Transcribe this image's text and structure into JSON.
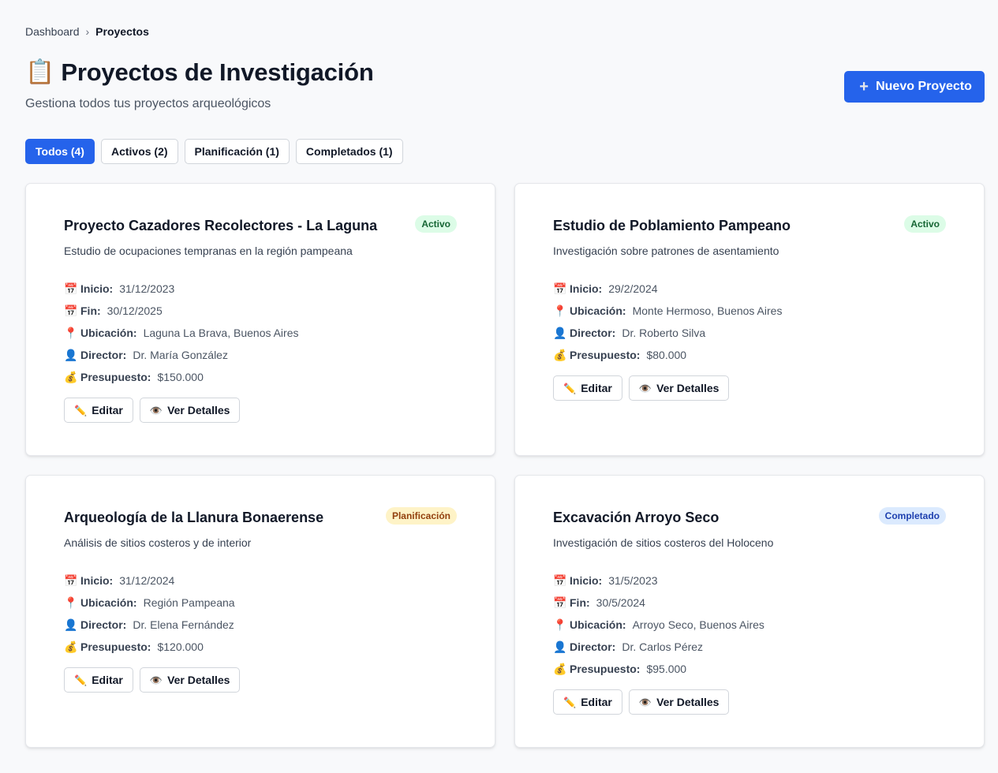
{
  "breadcrumb": {
    "root": "Dashboard",
    "separator": "›",
    "current": "Proyectos"
  },
  "header": {
    "icon": "📋",
    "title": "Proyectos de Investigación",
    "subtitle": "Gestiona todos tus proyectos arqueológicos",
    "new_button_icon": "+",
    "new_button": "Nuevo Proyecto"
  },
  "filters": [
    {
      "label": "Todos (4)",
      "active": true
    },
    {
      "label": "Activos (2)",
      "active": false
    },
    {
      "label": "Planificación (1)",
      "active": false
    },
    {
      "label": "Completados (1)",
      "active": false
    }
  ],
  "icons": {
    "calendar": "📅",
    "pin": "📍",
    "person": "👤",
    "money": "💰",
    "pencil": "✏️",
    "eye": "👁️"
  },
  "labels": {
    "inicio": "Inicio:",
    "fin": "Fin:",
    "ubicacion": "Ubicación:",
    "director": "Director:",
    "presupuesto": "Presupuesto:",
    "edit": "Editar",
    "details": "Ver Detalles"
  },
  "projects": [
    {
      "title": "Proyecto Cazadores Recolectores - La Laguna",
      "status": "Activo",
      "status_class": "activo",
      "description": "Estudio de ocupaciones tempranas en la región pampeana",
      "inicio": "31/12/2023",
      "fin": "30/12/2025",
      "ubicacion": "Laguna La Brava, Buenos Aires",
      "director": "Dr. María González",
      "presupuesto": "$150.000"
    },
    {
      "title": "Estudio de Poblamiento Pampeano",
      "status": "Activo",
      "status_class": "activo",
      "description": "Investigación sobre patrones de asentamiento",
      "inicio": "29/2/2024",
      "fin": null,
      "ubicacion": "Monte Hermoso, Buenos Aires",
      "director": "Dr. Roberto Silva",
      "presupuesto": "$80.000"
    },
    {
      "title": "Arqueología de la Llanura Bonaerense",
      "status": "Planificación",
      "status_class": "planificacion",
      "description": "Análisis de sitios costeros y de interior",
      "inicio": "31/12/2024",
      "fin": null,
      "ubicacion": "Región Pampeana",
      "director": "Dr. Elena Fernández",
      "presupuesto": "$120.000"
    },
    {
      "title": "Excavación Arroyo Seco",
      "status": "Completado",
      "status_class": "completado",
      "description": "Investigación de sitios costeros del Holoceno",
      "inicio": "31/5/2023",
      "fin": "30/5/2024",
      "ubicacion": "Arroyo Seco, Buenos Aires",
      "director": "Dr. Carlos Pérez",
      "presupuesto": "$95.000"
    }
  ]
}
